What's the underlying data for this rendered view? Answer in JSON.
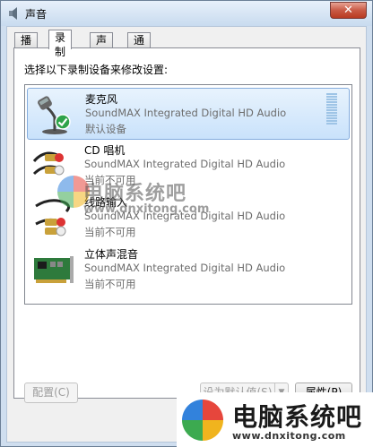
{
  "window": {
    "title": "声音",
    "close_label": "✕"
  },
  "tabs": [
    {
      "label": "播放",
      "active": false
    },
    {
      "label": "录制",
      "active": true
    },
    {
      "label": "声音",
      "active": false
    },
    {
      "label": "通信",
      "active": false
    }
  ],
  "instruction": "选择以下录制设备来修改设置:",
  "devices": [
    {
      "name": "麦克风",
      "description": "SoundMAX Integrated Digital HD Audio",
      "status": "默认设备",
      "icon": "microphone-icon",
      "selected": true,
      "default": true
    },
    {
      "name": "CD 唱机",
      "description": "SoundMAX Integrated Digital HD Audio",
      "status": "当前不可用",
      "icon": "cd-player-icon",
      "selected": false
    },
    {
      "name": "线路输入",
      "description": "SoundMAX Integrated Digital HD Audio",
      "status": "当前不可用",
      "icon": "line-in-icon",
      "selected": false
    },
    {
      "name": "立体声混音",
      "description": "SoundMAX Integrated Digital HD Audio",
      "status": "当前不可用",
      "icon": "sound-card-icon",
      "selected": false
    }
  ],
  "buttons": {
    "configure": "配置(C)",
    "set_default": "设为默认值(S)",
    "properties": "属性(P)"
  },
  "watermark": {
    "text": "电脑系统吧",
    "url": "www.dnxitong.com",
    "brand_text": "电脑系统吧",
    "brand_url": "www.dnxitong.com"
  },
  "colors": {
    "selection": "#c9e2fb",
    "accent": "#3a7bd5",
    "close": "#c95a45"
  }
}
